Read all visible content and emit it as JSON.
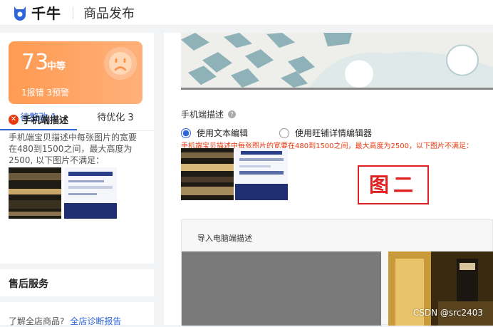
{
  "header": {
    "app_name": "千牛",
    "page_title": "商品发布"
  },
  "score": {
    "value": "73",
    "level": "中等",
    "summary": "1报错 3预警"
  },
  "tabs": [
    {
      "label": "待整改 1",
      "active": true
    },
    {
      "label": "待优化 3",
      "active": false
    }
  ],
  "issue": {
    "title": "手机端描述",
    "description": "手机端宝贝描述中每张图片的宽要在480到1500之间，最大高度为2500, 以下图片不满足："
  },
  "after_sales": {
    "title": "售后服务"
  },
  "bottom": {
    "text": "了解全店商品?",
    "link": "全店诊断报告"
  },
  "mobile_desc": {
    "label": "手机端描述",
    "options": [
      {
        "label": "使用文本编辑",
        "checked": true
      },
      {
        "label": "使用旺铺详情编辑器",
        "checked": false
      }
    ],
    "warning": "手机端宝贝描述中每张图片的宽要在480到1500之间，最大高度为2500，以下图片不满足："
  },
  "stamp": "图二",
  "import": {
    "label": "导入电脑端描述"
  },
  "watermark": "CSDN @src2403",
  "colors": {
    "accent": "#2e66d9",
    "error": "#e8380d",
    "score_card": "#ff9a52"
  }
}
